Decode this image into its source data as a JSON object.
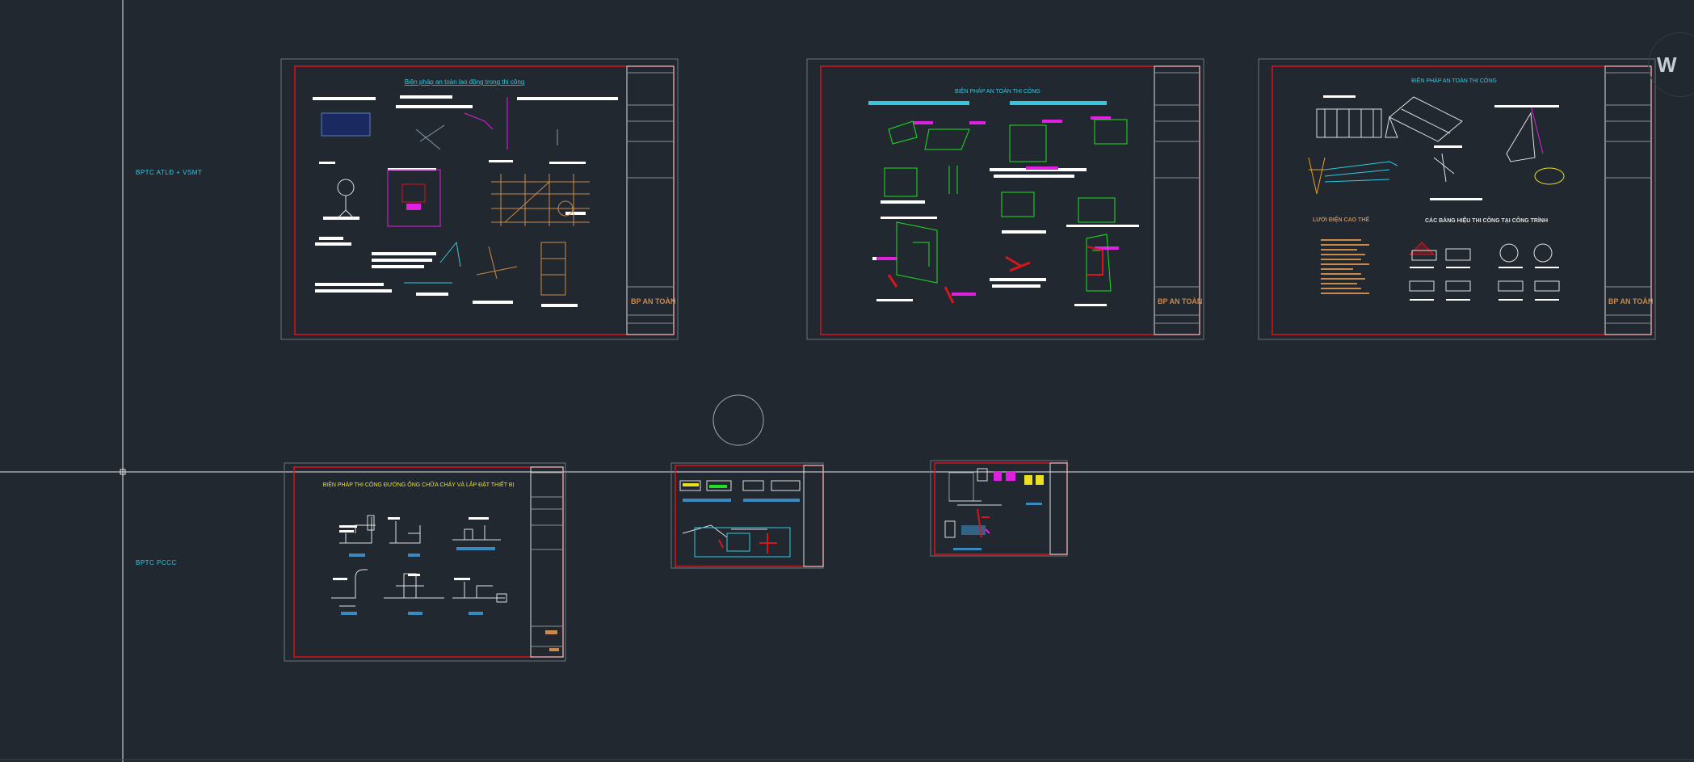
{
  "layout_labels": {
    "group1": "BPTC ATLĐ + VSMT",
    "group2": "BPTC PCCC"
  },
  "sheets": {
    "sheet1": {
      "title": "Biện pháp an toàn lao động trong thi công",
      "stamp": "BP AN TOÀN"
    },
    "sheet2": {
      "title": "BIỆN PHÁP AN TOÀN THI CÔNG",
      "stamp": "BP AN TOÀN"
    },
    "sheet3": {
      "title": "BIỆN PHÁP AN TOÀN THI CÔNG",
      "stamp": "BP AN TOÀN",
      "subtitle1": "LƯỚI ĐIỆN CAO THẾ",
      "subtitle2": "CÁC BẢNG HIỆU THI CÔNG TẠI CÔNG TRÌNH"
    },
    "sheet4": {
      "title": "BIỆN PHÁP THI CÔNG ĐƯỜNG ỐNG CHỮA CHÁY VÀ LẮP ĐẶT THIẾT BỊ"
    }
  },
  "viewcube_letter": "W",
  "colors": {
    "background": "#212830",
    "frame_red": "#d8141c",
    "cyan": "#34c8e0",
    "yellow": "#e8e020",
    "orange": "#c98a4b",
    "magenta": "#e020e0",
    "green": "#20e020",
    "crosshair": "#e8e8e8"
  }
}
